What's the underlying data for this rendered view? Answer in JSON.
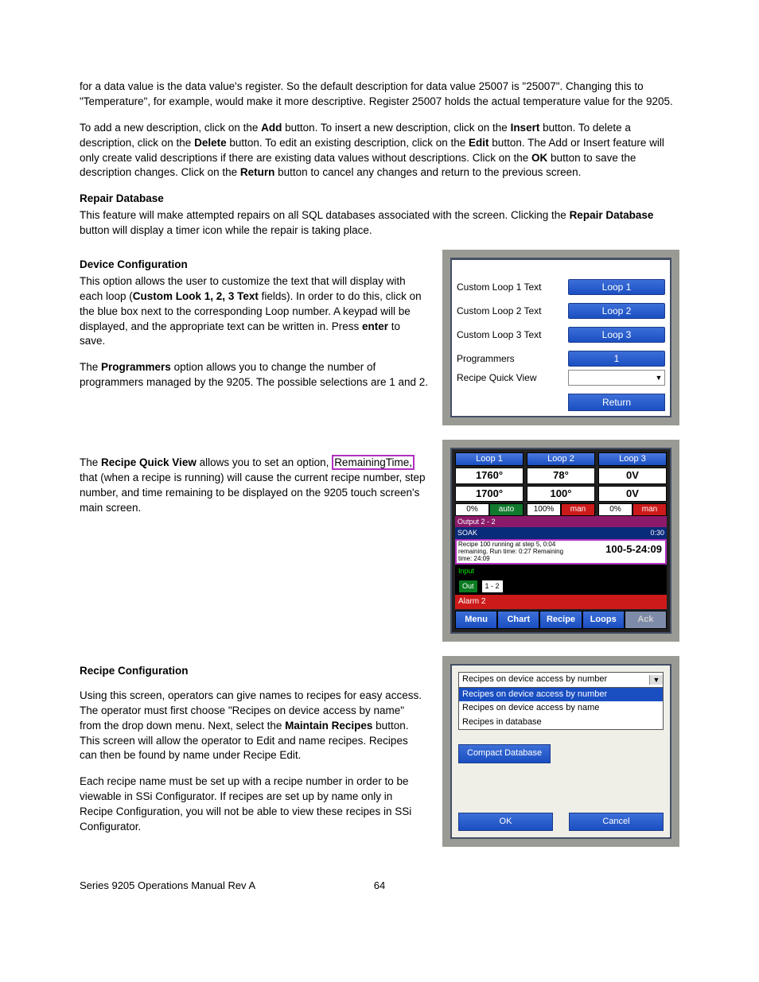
{
  "intro": {
    "p1": "for a data value is the data value's register.  So the default description for data value 25007 is \"25007\".  Changing this to \"Temperature\", for example, would make it more descriptive. Register 25007 holds the actual temperature value for the 9205.",
    "p2a": "To add a new description, click on the ",
    "add": "Add",
    "p2b": " button.  To insert a new description, click on the ",
    "insert": "Insert",
    "p2c": " button.  To delete a description, click on the ",
    "delete": "Delete",
    "p2d": " button.  To edit an existing description, click on the ",
    "edit": "Edit",
    "p2e": " button.  The Add or Insert feature will only create valid descriptions if there are existing data values without descriptions.  Click on the ",
    "ok": "OK",
    "p2f": " button to save the description changes.  Click on the ",
    "return": "Return",
    "p2g": " button to cancel any changes and return to the previous screen."
  },
  "repair": {
    "title": "Repair Database",
    "p1a": "This feature will make attempted repairs on all SQL databases associated with the screen.  Clicking the ",
    "bold": "Repair Database",
    "p1b": " button will display a timer icon while the repair is taking place."
  },
  "devcfg": {
    "title": "Device Configuration",
    "p1a": "This option allows the user to customize the text that will display with each loop (",
    "bold1": "Custom Look 1, 2, 3 Text",
    "p1b": " fields).  In order to do this, click on the blue box next to the corresponding Loop number.  A keypad will be displayed, and the appropriate text can be written in.  Press ",
    "bold2": "enter",
    "p1c": " to save.",
    "p2a": "The ",
    "bold3": "Programmers",
    "p2b": " option allows you to change the number of programmers managed by the 9205. The possible selections are 1 and 2.",
    "p3a": "The ",
    "bold4": "Recipe Quick View",
    "p3b": " allows you to set an option, ",
    "hl": "RemainingTime,",
    "p3c": " that (when a recipe is running) will cause the current recipe number, step number, and time remaining to be displayed on the 9205 touch screen's main screen."
  },
  "shot1": {
    "r1": "Custom Loop 1 Text",
    "v1": "Loop 1",
    "r2": "Custom Loop 2 Text",
    "v2": "Loop 2",
    "r3": "Custom Loop 3 Text",
    "v3": "Loop 3",
    "r4": "Programmers",
    "v4": "1",
    "r5": "Recipe Quick View",
    "return": "Return"
  },
  "shot2": {
    "loop1": {
      "hd": "Loop 1",
      "v1": "1760°",
      "v2": "1700°",
      "pct": "0%",
      "mode": "auto"
    },
    "loop2": {
      "hd": "Loop 2",
      "v1": "78°",
      "v2": "100°",
      "pct": "100%",
      "mode": "man"
    },
    "loop3": {
      "hd": "Loop 3",
      "v1": "0V",
      "v2": "0V",
      "pct": "0%",
      "mode": "man"
    },
    "output": "Output 2 - 2",
    "soak": "SOAK",
    "soak_time": "0:30",
    "recipe_txt": "Recipe 100 running at step 5, 0:04 remaining. Run time: 0:27 Remaining time: 24:09",
    "recipe_disp": "100-5-24:09",
    "input": "Input",
    "out": "Out",
    "out_v": "1 - 2",
    "alarm": "Alarm 2",
    "nav": [
      "Menu",
      "Chart",
      "Recipe",
      "Loops",
      "Ack"
    ]
  },
  "recipe": {
    "title": "Recipe Configuration",
    "p1a": "Using this screen, operators can give names to recipes for easy access.  The operator must first choose \"Recipes on device access by name\" from the drop down menu.  Next, select the ",
    "bold": "Maintain Recipes",
    "p1b": " button.  This screen will allow the operator to Edit and name recipes.  Recipes can then be found by name under Recipe Edit.",
    "p2": "Each recipe name must be set up with a recipe number in order to be viewable in SSi Configurator. If recipes are set up by name only in Recipe Configuration, you will not be able to view these recipes in SSi Configurator."
  },
  "shot3": {
    "selected": "Recipes on device access by number",
    "opts": [
      "Recipes on device access by number",
      "Recipes on device access by name",
      "Recipes in database"
    ],
    "compact": "Compact Database",
    "ok": "OK",
    "cancel": "Cancel"
  },
  "footer": {
    "left": "Series 9205 Operations Manual Rev A",
    "page": "64"
  }
}
